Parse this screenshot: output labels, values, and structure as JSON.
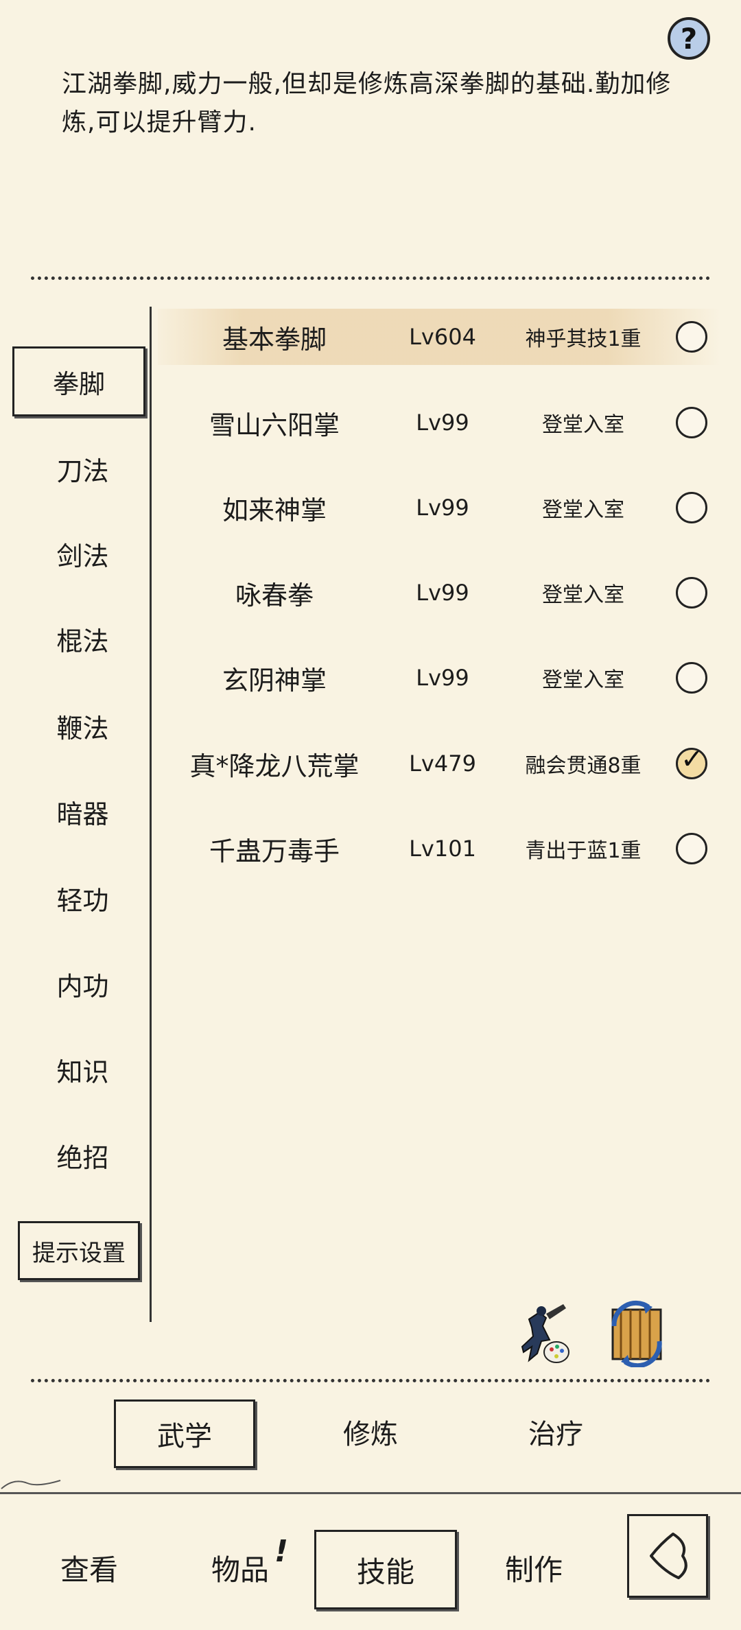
{
  "help": {
    "glyph": "?"
  },
  "description": "江湖拳脚,威力一般,但却是修炼高深拳脚的基础.勤加修炼,可以提升臂力.",
  "categories": [
    {
      "label": "拳脚",
      "selected": true
    },
    {
      "label": "刀法"
    },
    {
      "label": "剑法"
    },
    {
      "label": "棍法"
    },
    {
      "label": "鞭法"
    },
    {
      "label": "暗器"
    },
    {
      "label": "轻功"
    },
    {
      "label": "内功"
    },
    {
      "label": "知识"
    },
    {
      "label": "绝招"
    }
  ],
  "tip_settings": "提示设置",
  "skills": [
    {
      "name": "基本拳脚",
      "level": "Lv604",
      "rank": "神乎其技1重",
      "checked": false,
      "highlighted": true
    },
    {
      "name": "雪山六阳掌",
      "level": "Lv99",
      "rank": "登堂入室",
      "checked": false
    },
    {
      "name": "如来神掌",
      "level": "Lv99",
      "rank": "登堂入室",
      "checked": false
    },
    {
      "name": "咏春拳",
      "level": "Lv99",
      "rank": "登堂入室",
      "checked": false
    },
    {
      "name": "玄阴神掌",
      "level": "Lv99",
      "rank": "登堂入室",
      "checked": false
    },
    {
      "name": "真*降龙八荒掌",
      "level": "Lv479",
      "rank": "融会贯通8重",
      "checked": true
    },
    {
      "name": "千蛊万毒手",
      "level": "Lv101",
      "rank": "青出于蓝1重",
      "checked": false
    }
  ],
  "subtabs": [
    "武学",
    "修炼",
    "治疗"
  ],
  "nav": {
    "view": "查看",
    "items": "物品",
    "items_badge": "!",
    "skills": "技能",
    "craft": "制作"
  },
  "icons": {
    "fighter": "martial-artist-palette-icon",
    "swap": "scroll-swap-icon",
    "back": "back-arrow-icon"
  },
  "colors": {
    "background": "#f9f3e2",
    "highlight": "#ecd6b0",
    "check_fill": "#f3dca3",
    "help_fill": "#b9cde8"
  }
}
